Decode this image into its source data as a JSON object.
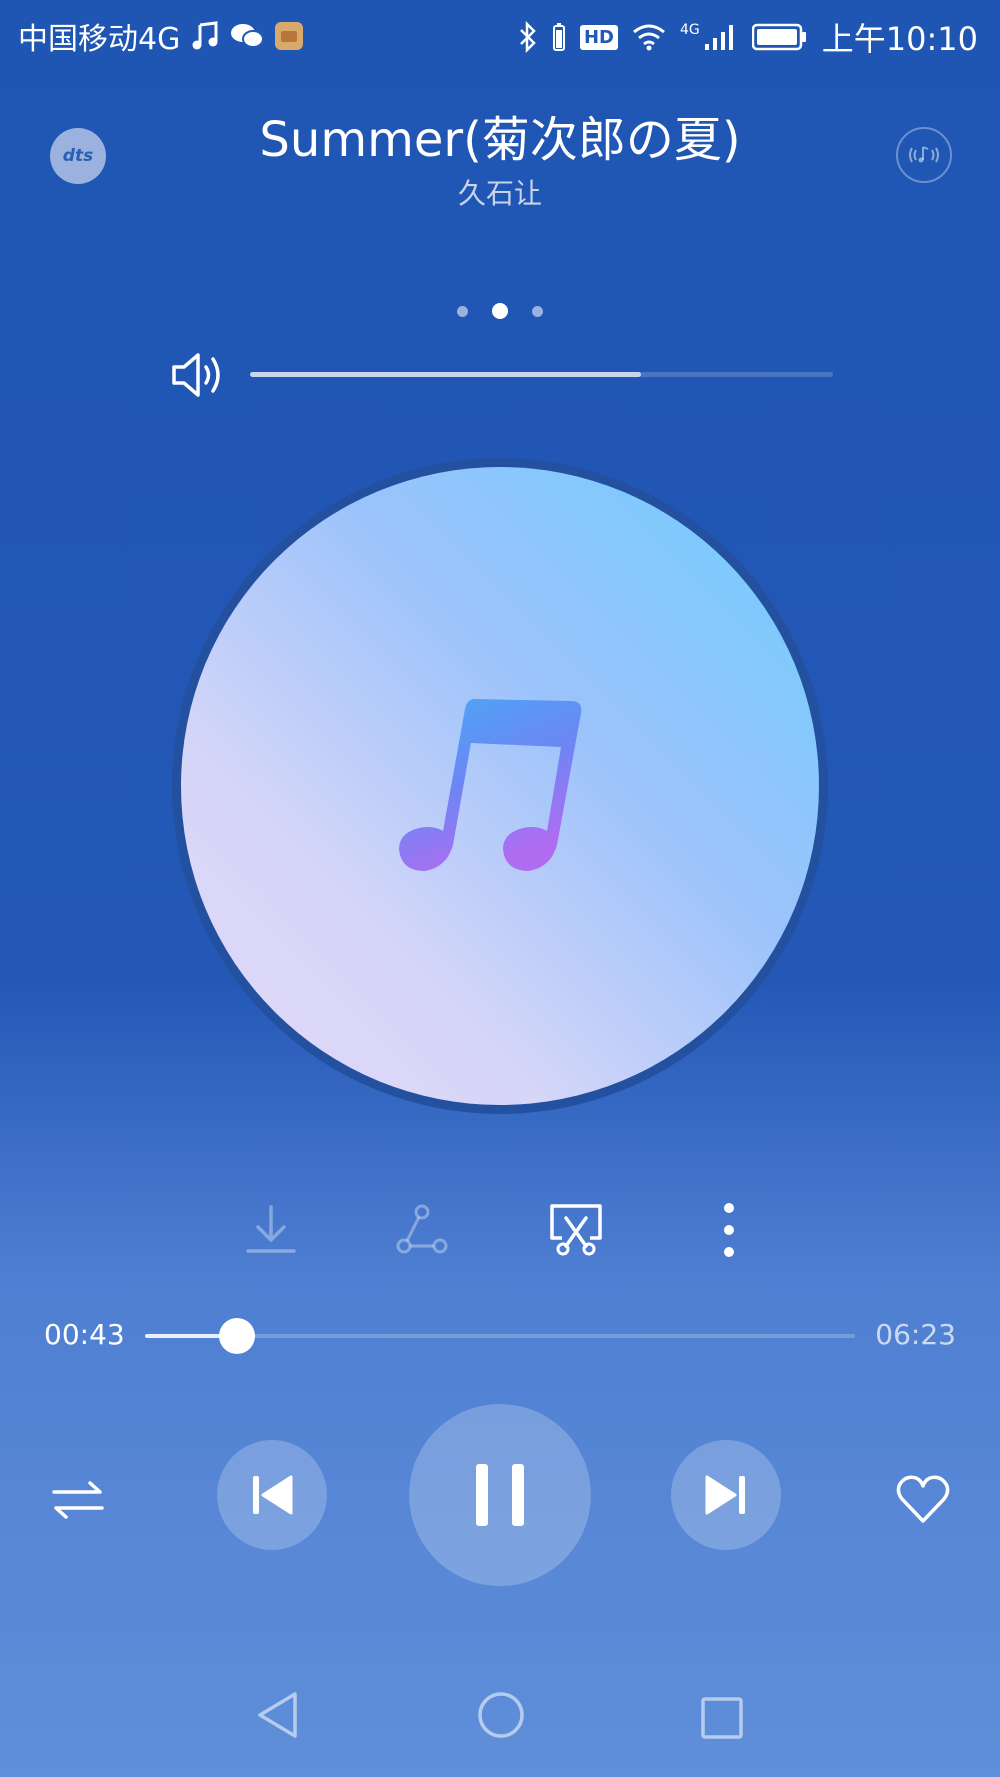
{
  "status_bar": {
    "carrier": "中国移动4G",
    "hd_label": "HD",
    "network_label": "4G",
    "time": "上午10:10"
  },
  "header": {
    "dts_label": "dts",
    "title": "Summer(菊次郎の夏)",
    "artist": "久石让"
  },
  "pager": {
    "count": 3,
    "active_index": 1
  },
  "volume": {
    "level": 0.67
  },
  "progress": {
    "current": "00:43",
    "total": "06:23",
    "fraction": 0.13
  },
  "colors": {
    "accent": "#2358b7",
    "note_gradient_start": "#4aa8f5",
    "note_gradient_end": "#a86cf2"
  },
  "icons": {
    "status": [
      "music-icon",
      "wechat-icon",
      "app-icon",
      "bluetooth-icon",
      "wifi-icon",
      "signal-icon",
      "battery-icon"
    ],
    "actions": [
      "download-icon",
      "share-icon",
      "cut-ringtone-icon",
      "more-icon"
    ],
    "controls": [
      "repeat-mode-icon",
      "previous-icon",
      "pause-icon",
      "next-icon",
      "heart-icon"
    ],
    "nav": [
      "back-icon",
      "home-icon",
      "recents-icon"
    ]
  }
}
